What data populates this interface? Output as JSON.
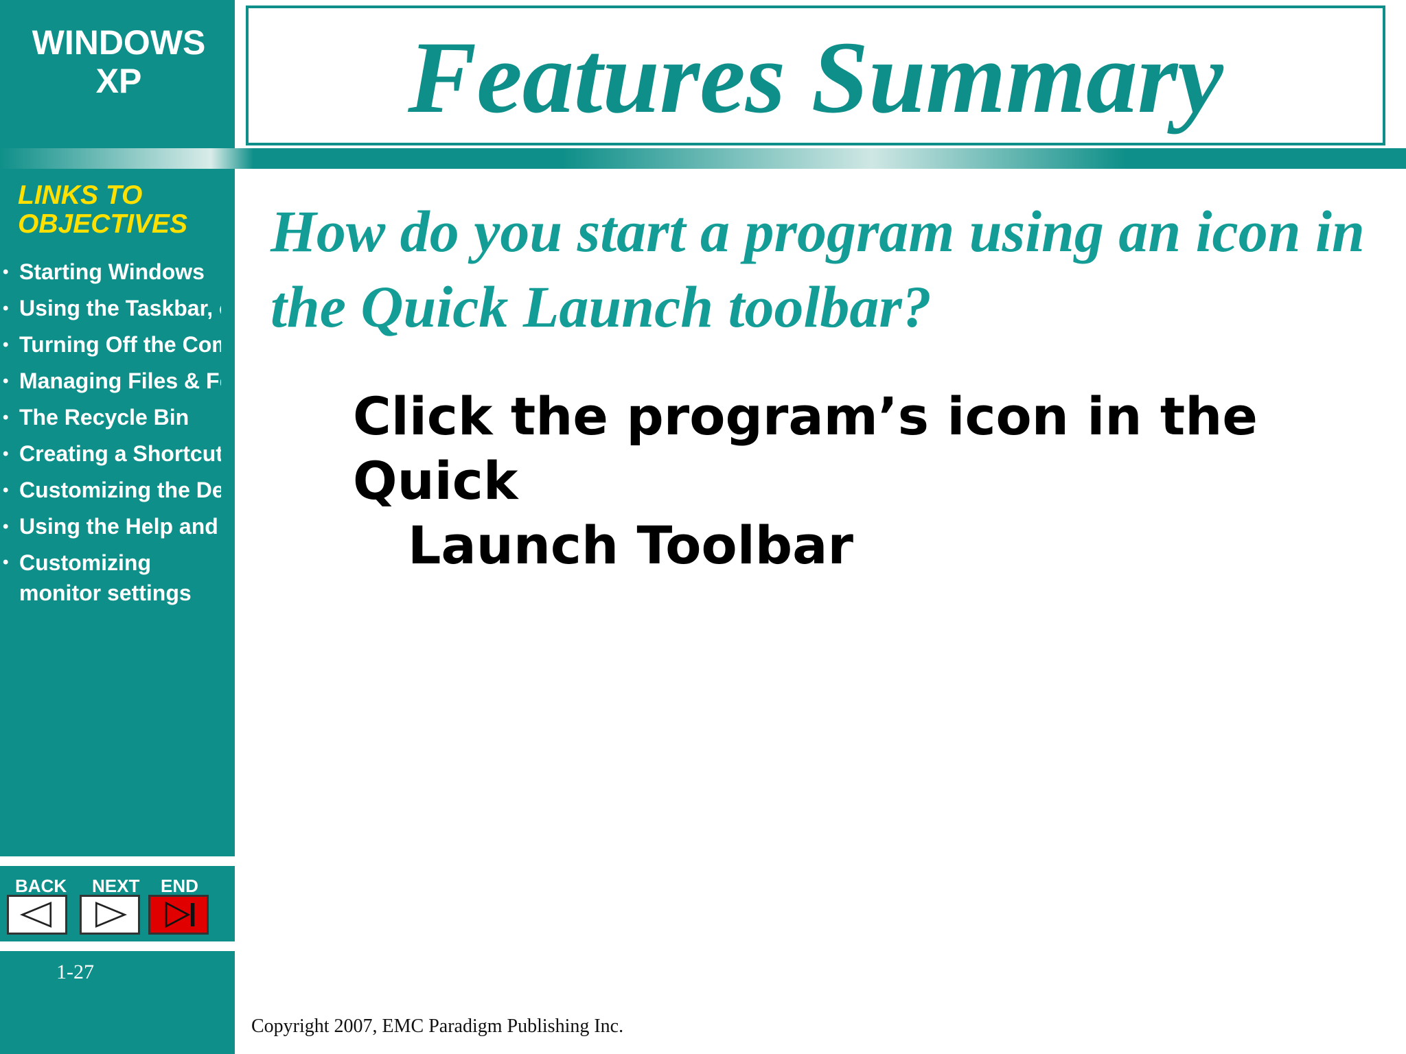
{
  "brand": {
    "line1": "WINDOWS",
    "line2": "XP"
  },
  "title": "Features Summary",
  "links": {
    "heading_line1": "LINKS TO",
    "heading_line2": "OBJECTIVES",
    "items": [
      "Starting Windows",
      "Using the Taskbar, o",
      "Turning Off the Com",
      "Managing Files & Fol",
      "The Recycle Bin",
      "Creating a Shortcut",
      "Customizing the Des",
      "Using the Help and S",
      "Customizing monitor settings"
    ]
  },
  "question": "How do you start a program using an icon in the Quick Launch toolbar?",
  "answer": {
    "line1": "Click the program’s icon in the Quick",
    "line2": "Launch Toolbar"
  },
  "nav": {
    "back": "BACK",
    "next": "NEXT",
    "end": "END"
  },
  "page_number": "1-27",
  "copyright": "Copyright 2007, EMC Paradigm Publishing Inc.",
  "colors": {
    "teal": "#0f8f89",
    "heading_yellow": "#ffe000",
    "end_red": "#e00000"
  }
}
